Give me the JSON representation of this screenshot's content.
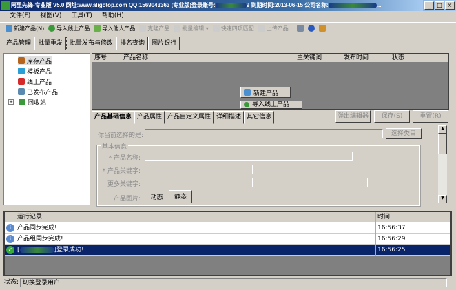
{
  "window": {
    "title_prefix": "阿里先锋-专业版 V5.0  网址:www.aligotop.com QQ:1569043363 (专业版)登录账号:",
    "title_account_tail": "9",
    "title_expiry": " 到期时间:2013-06-15   公司名称:",
    "title_company_tail": "...",
    "buttons": [
      "_",
      "□",
      "×"
    ]
  },
  "menu": [
    "文件(F)",
    "视图(V)",
    "工具(T)",
    "帮助(H)"
  ],
  "toolbar": [
    {
      "label": "新建产品(N)",
      "icon": "new-product-icon",
      "enabled": true
    },
    {
      "label": "导入线上产品",
      "icon": "download-icon",
      "enabled": true
    },
    {
      "label": "导入他人产品",
      "icon": "import-icon",
      "enabled": true
    },
    {
      "label": "克隆产品",
      "icon": "clone-icon",
      "enabled": false
    },
    {
      "label": "批量编辑 ▾",
      "icon": "batch-edit-icon",
      "enabled": false
    },
    {
      "label": "快速四项匹配",
      "icon": "match-icon",
      "enabled": false
    },
    {
      "label": "上传产品",
      "icon": "upload-icon",
      "enabled": false
    }
  ],
  "main_tabs": [
    "产品管理",
    "批量重发",
    "批量发布与修改",
    "排名查询",
    "图片银行"
  ],
  "tree": [
    {
      "label": "库存产品",
      "color": "#b5651d"
    },
    {
      "label": "模板产品",
      "color": "#2a9fd6"
    },
    {
      "label": "线上产品",
      "color": "#d62a2a"
    },
    {
      "label": "已发布产品",
      "color": "#5a8ab0"
    },
    {
      "label": "回收站",
      "color": "#3a9a3a"
    }
  ],
  "grid": {
    "columns": [
      "序号",
      "产品名称",
      "主关键词",
      "发布时间",
      "状态"
    ],
    "float_buttons": [
      "新建产品",
      "导入线上产品"
    ]
  },
  "detail_tabs": [
    "产品基础信息",
    "产品属性",
    "产品自定义属性",
    "详细描述",
    "其它信息"
  ],
  "detail_buttons": [
    "弹出编辑器",
    "保存(S)",
    "重置(R)"
  ],
  "form": {
    "current_label": "你当前选择的是:",
    "choose_category": "选择类目",
    "group_title": "基本信息",
    "name_label": "* 产品名称:",
    "keyword_label": "* 产品关键字:",
    "more_keywords_label": "更多关键字:",
    "image_label": "产品图片:",
    "image_tabs": [
      "动态",
      "静态"
    ]
  },
  "log": {
    "columns": [
      "运行记录",
      "时间"
    ],
    "rows": [
      {
        "message": "产品同步完成!",
        "time": "16:56:37",
        "type": "info"
      },
      {
        "message": "产品组同步完成!",
        "time": "16:56:29",
        "type": "info"
      },
      {
        "message": "]登录成功!",
        "time": "16:56:25",
        "type": "success"
      }
    ]
  },
  "status": {
    "label": "状态:",
    "text": "切换登录用户"
  }
}
